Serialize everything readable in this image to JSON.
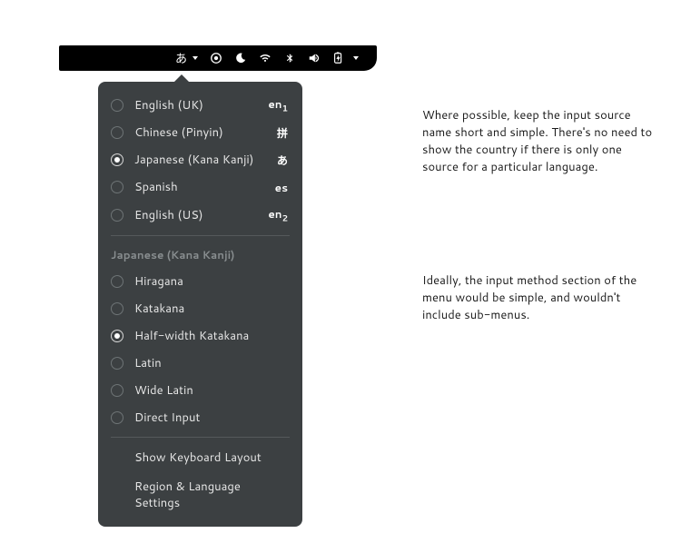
{
  "topbar": {
    "ime_indicator": "あ",
    "icons": [
      "target",
      "night",
      "wifi",
      "bluetooth",
      "volume",
      "battery"
    ]
  },
  "menu": {
    "sources": [
      {
        "label": "English (UK)",
        "indicator": "en",
        "sub": "1",
        "selected": false
      },
      {
        "label": "Chinese (Pinyin)",
        "indicator": "拼",
        "sub": "",
        "selected": false
      },
      {
        "label": "Japanese (Kana Kanji)",
        "indicator": "あ",
        "sub": "",
        "selected": true
      },
      {
        "label": "Spanish",
        "indicator": "es",
        "sub": "",
        "selected": false
      },
      {
        "label": "English (US)",
        "indicator": "en",
        "sub": "2",
        "selected": false
      }
    ],
    "section_header": "Japanese (Kana Kanji)",
    "modes": [
      {
        "label": "Hiragana",
        "selected": false
      },
      {
        "label": "Katakana",
        "selected": false
      },
      {
        "label": "Half-width Katakana",
        "selected": true
      },
      {
        "label": "Latin",
        "selected": false
      },
      {
        "label": "Wide Latin",
        "selected": false
      },
      {
        "label": "Direct Input",
        "selected": false
      }
    ],
    "actions": {
      "show_layout": "Show Keyboard Layout",
      "region_settings": "Region & Language Settings"
    }
  },
  "annotations": {
    "a1": "Where possible, keep the input source name short and simple. There's no need to show the country if there is only one source for a particular language.",
    "a2": "Ideally, the input method section of the menu would be simple, and wouldn't include sub-menus."
  }
}
